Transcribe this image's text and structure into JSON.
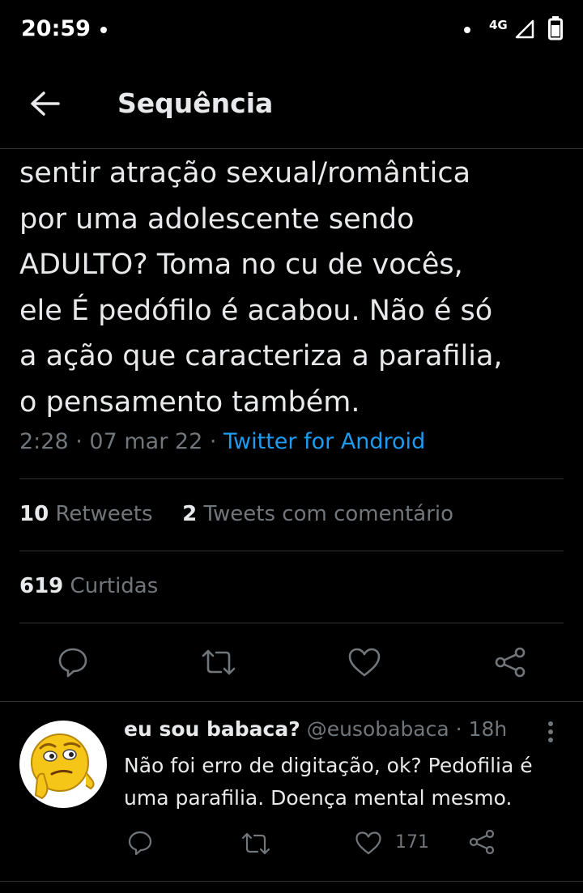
{
  "status_bar": {
    "time": "20:59",
    "network": "4G"
  },
  "header": {
    "title": "Sequência"
  },
  "tweet": {
    "text": "sentir atração sexual/romântica\npor uma adolescente sendo\nADULTO? Toma no cu de vocês,\nele É pedófilo é acabou. Não é só\na ação que caracteriza a parafilia,\no pensamento também.",
    "time": "2:28",
    "date": "07 mar 22",
    "sep": "·",
    "source": "Twitter for Android",
    "retweets_count": "10",
    "retweets_label": "Retweets",
    "quotes_count": "2",
    "quotes_label": "Tweets com comentário",
    "likes_count": "619",
    "likes_label": "Curtidas"
  },
  "reply": {
    "name": "eu sou babaca?",
    "handle": "@eusobabaca",
    "sep": "·",
    "age": "18h",
    "text": "Não foi erro de digitação, ok? Pedofilia é\numa parafilia. Doença mental mesmo.",
    "like_count": "171"
  },
  "colors": {
    "accent": "#1d9bf0",
    "muted": "#71767b",
    "text": "#e7e9ea",
    "divider": "#2f3336"
  }
}
